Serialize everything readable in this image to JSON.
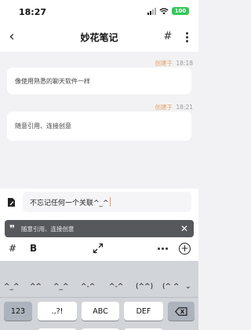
{
  "status_bar": {
    "time": "18:27",
    "battery": "100"
  },
  "nav": {
    "title": "妙花笔记"
  },
  "notes": [
    {
      "created_label": "创建于",
      "time": "18:18",
      "content": "像使用熟悉的聊天软件一样"
    },
    {
      "created_label": "创建于",
      "time": "18:21",
      "content": "随意引用、连接创意"
    }
  ],
  "composer": {
    "input_value": "不忘记任何一个关联^_^"
  },
  "quote_bar": {
    "text": "随意引用、连接创意"
  },
  "keyboard": {
    "emoticons": [
      "^_^",
      "^^",
      "^_^",
      "^-^",
      "^-^",
      "(^^)",
      "(^ ^"
    ],
    "keys": {
      "numbers": "123",
      "punct": ".,?!",
      "abc": "ABC",
      "def": "DEF"
    }
  },
  "colors": {
    "accent": "#e4a06a",
    "battery": "#34c759",
    "quote_bar": "#56585c",
    "keyboard_bg": "#d1d4d9"
  }
}
